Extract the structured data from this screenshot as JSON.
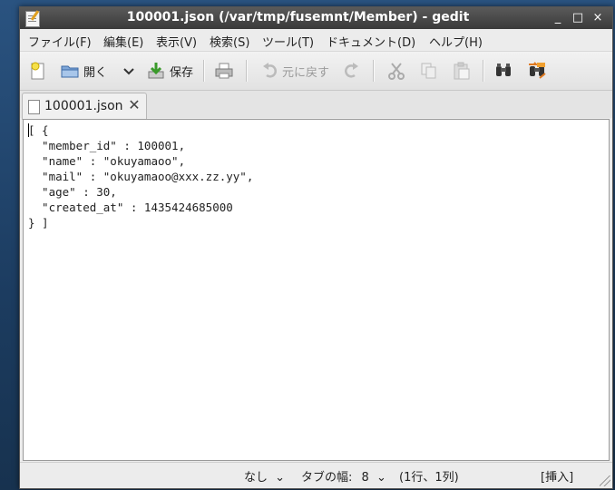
{
  "window": {
    "title": "100001.json (/var/tmp/fusemnt/Member) - gedit",
    "controls": {
      "minimize": "_",
      "maximize": "□",
      "close": "×"
    }
  },
  "menubar": {
    "items": [
      {
        "label": "ファイル(F)"
      },
      {
        "label": "編集(E)"
      },
      {
        "label": "表示(V)"
      },
      {
        "label": "検索(S)"
      },
      {
        "label": "ツール(T)"
      },
      {
        "label": "ドキュメント(D)"
      },
      {
        "label": "ヘルプ(H)"
      }
    ]
  },
  "toolbar": {
    "new_icon": "new-document-icon",
    "open_label": "開く",
    "open_dropdown_icon": "chevron-down-icon",
    "save_label": "保存",
    "print_icon": "printer-icon",
    "undo_label": "元に戻す",
    "redo_icon": "redo-icon",
    "cut_icon": "scissors-icon",
    "copy_icon": "copy-icon",
    "paste_icon": "paste-icon",
    "find_icon": "binoculars-icon",
    "replace_icon": "find-replace-icon"
  },
  "tabs": [
    {
      "label": "100001.json",
      "close": "✕"
    }
  ],
  "editor": {
    "content": "[ {\n  \"member_id\" : 100001,\n  \"name\" : \"okuyamaoo\",\n  \"mail\" : \"okuyamaoo@xxx.zz.yy\",\n  \"age\" : 30,\n  \"created_at\" : 1435424685000\n} ]"
  },
  "statusbar": {
    "language": "なし",
    "tab_width_label": "タブの幅:",
    "tab_width_value": "8",
    "position": "(1行、1列)",
    "mode": "[挿入]"
  }
}
